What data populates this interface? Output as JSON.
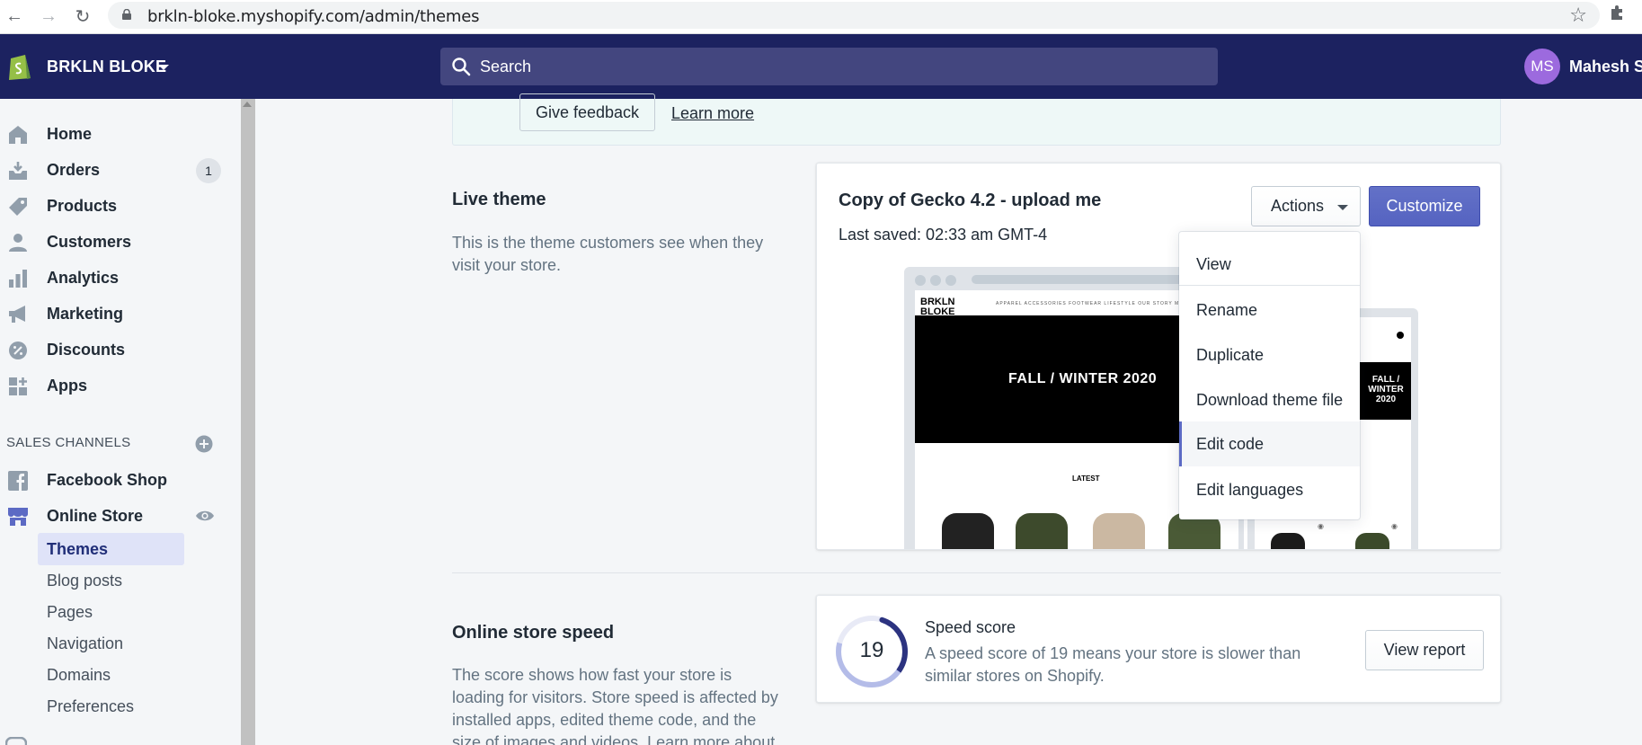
{
  "browser": {
    "url": "brkln-bloke.myshopify.com/admin/themes"
  },
  "topbar": {
    "store_name": "BRKLN BLOKE",
    "search_placeholder": "Search",
    "avatar_initials": "MS",
    "user_name": "Mahesh Si"
  },
  "sidebar": {
    "items": [
      {
        "label": "Home",
        "icon": "home-icon"
      },
      {
        "label": "Orders",
        "icon": "orders-icon",
        "badge": "1"
      },
      {
        "label": "Products",
        "icon": "tag-icon"
      },
      {
        "label": "Customers",
        "icon": "person-icon"
      },
      {
        "label": "Analytics",
        "icon": "bar-chart-icon"
      },
      {
        "label": "Marketing",
        "icon": "megaphone-icon"
      },
      {
        "label": "Discounts",
        "icon": "discount-icon"
      },
      {
        "label": "Apps",
        "icon": "apps-icon"
      }
    ],
    "sales_channels_heading": "SALES CHANNELS",
    "channels": [
      {
        "label": "Facebook Shop",
        "icon": "facebook-icon"
      },
      {
        "label": "Online Store",
        "icon": "store-icon"
      }
    ],
    "online_store_sub": [
      "Themes",
      "Blog posts",
      "Pages",
      "Navigation",
      "Domains",
      "Preferences"
    ]
  },
  "banner": {
    "feedback_label": "Give feedback",
    "learn_more_label": "Learn more"
  },
  "live_theme": {
    "section_title": "Live theme",
    "section_desc_line1": "This is the theme customers see when they",
    "section_desc_line2": "visit your store.",
    "theme_name": "Copy of Gecko 4.2 - upload me",
    "last_saved": "Last saved: 02:33 am GMT-4",
    "actions_label": "Actions",
    "customize_label": "Customize",
    "preview": {
      "brand_line1": "BRKLN",
      "brand_line2": "BLOKE",
      "menu": "APPAREL   ACCESSORIES   FOOTWEAR   LIFESTYLE   OUR STORY   MEDIA",
      "hero": "FALL / WINTER 2020",
      "latest": "LATEST",
      "mobile_hero_1": "FALL /",
      "mobile_hero_2": "WINTER",
      "mobile_hero_3": "2020"
    }
  },
  "actions_menu": {
    "items": [
      "View",
      "Rename",
      "Duplicate",
      "Download theme file",
      "Edit code",
      "Edit languages"
    ],
    "highlighted": "Edit code"
  },
  "speed": {
    "section_title": "Online store speed",
    "section_desc": [
      "The score shows how fast your store is",
      "loading for visitors. Store speed is affected by",
      "installed apps, edited theme code, and the",
      "size of images and videos. Learn more about"
    ],
    "score": "19",
    "score_fraction": 0.19,
    "title": "Speed score",
    "desc_line1": "A speed score of 19 means your store is slower than",
    "desc_line2": "similar stores on Shopify.",
    "report_label": "View report"
  },
  "colors": {
    "topnav": "#1c2260",
    "accent": "#5c6ac4",
    "avatar": "#9c6ade",
    "logo_green": "#95bf47"
  }
}
